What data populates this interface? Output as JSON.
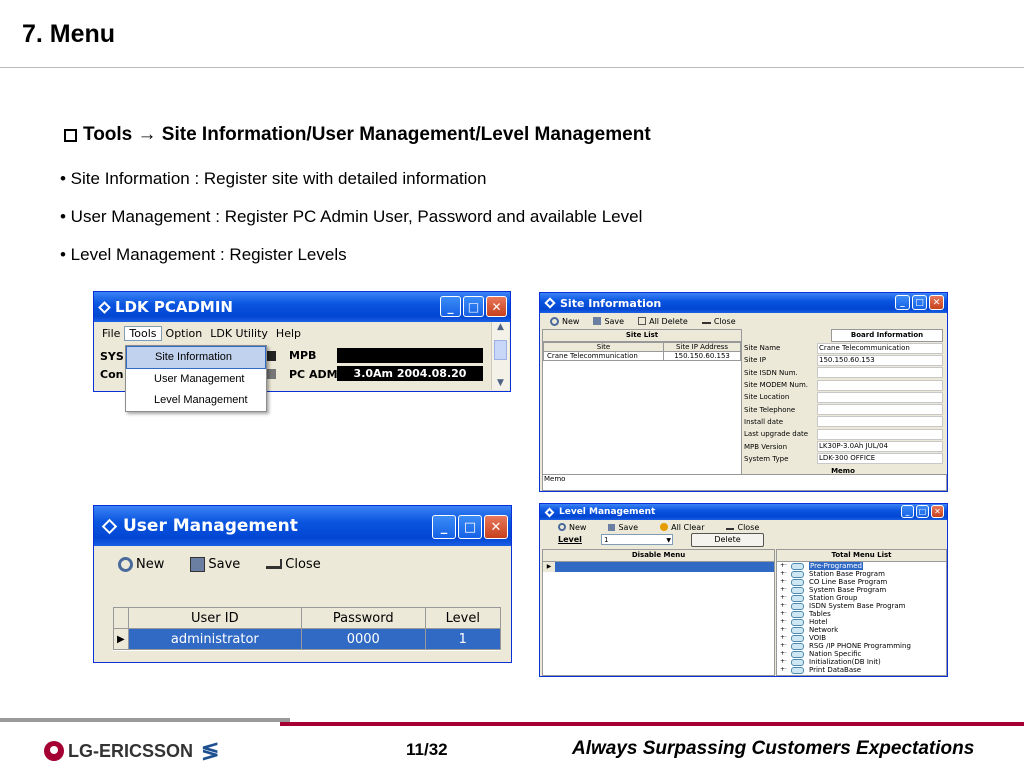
{
  "slide": {
    "title": "7. Menu",
    "heading": "Tools → Site Information/User Management/Level Management",
    "bullets": [
      "• Site Information : Register site with detailed information",
      "• User Management : Register PC Admin User, Password and available Level",
      "• Level Management : Register Levels"
    ],
    "page": "11/32",
    "tagline": "Always Surpassing Customers Expectations",
    "logo": "LG-ERICSSON"
  },
  "colors": {
    "accent": "#a50034",
    "xp_title": "#0a55e0",
    "selection": "#316ac5"
  },
  "pcadmin": {
    "title": "LDK PCADMIN",
    "menus": [
      "File",
      "Tools",
      "Option",
      "LDK Utility",
      "Help"
    ],
    "tools_items": [
      "Site Information",
      "User Management",
      "Level Management"
    ],
    "row_labels": [
      "SYS",
      "Con"
    ],
    "mpb_label": "MPB",
    "pcadm_label": "PC ADM",
    "pcadm_value": "3.0Am 2004.08.20"
  },
  "site_info": {
    "title": "Site Information",
    "toolbar": [
      "New",
      "Save",
      "All Delete",
      "Close"
    ],
    "list_header": "Site List",
    "columns": [
      "Site",
      "Site IP Address"
    ],
    "rows": [
      [
        "Crane Telecommunication",
        "150.150.60.153"
      ]
    ],
    "board_header": "Board Information",
    "fields": [
      {
        "label": "Site Name",
        "value": "Crane Telecommunication"
      },
      {
        "label": "Site IP",
        "value": "150.150.60.153"
      },
      {
        "label": "Site ISDN Num.",
        "value": ""
      },
      {
        "label": "Site MODEM Num.",
        "value": ""
      },
      {
        "label": "Site Location",
        "value": ""
      },
      {
        "label": "Site Telephone",
        "value": ""
      },
      {
        "label": "Install date",
        "value": ""
      },
      {
        "label": "Last upgrade date",
        "value": ""
      },
      {
        "label": "MPB Version",
        "value": "LK30P-3.0Ah JUL/04"
      },
      {
        "label": "System Type",
        "value": "LDK-300 OFFICE"
      }
    ],
    "memo_header": "Memo",
    "memo_label": "Memo"
  },
  "user_mgmt": {
    "title": "User Management",
    "toolbar": [
      "New",
      "Save",
      "Close"
    ],
    "columns": [
      "User ID",
      "Password",
      "Level"
    ],
    "rows": [
      [
        "administrator",
        "0000",
        "1"
      ]
    ]
  },
  "level_mgmt": {
    "title": "Level Management",
    "toolbar": [
      "New",
      "Save",
      "All Clear",
      "Close"
    ],
    "level_label": "Level",
    "level_value": "1",
    "delete_label": "Delete",
    "disable_header": "Disable Menu",
    "total_header": "Total Menu List",
    "menu_items": [
      "Pre-Programed",
      "Station Base Program",
      "CO Line Base Program",
      "System Base Program",
      "Station Group",
      "ISDN System Base Program",
      "Tables",
      "Hotel",
      "Network",
      "VOIB",
      "RSG /IP PHONE Programming",
      "Nation Specific",
      "Initialization(DB Init)",
      "Print DataBase"
    ]
  }
}
